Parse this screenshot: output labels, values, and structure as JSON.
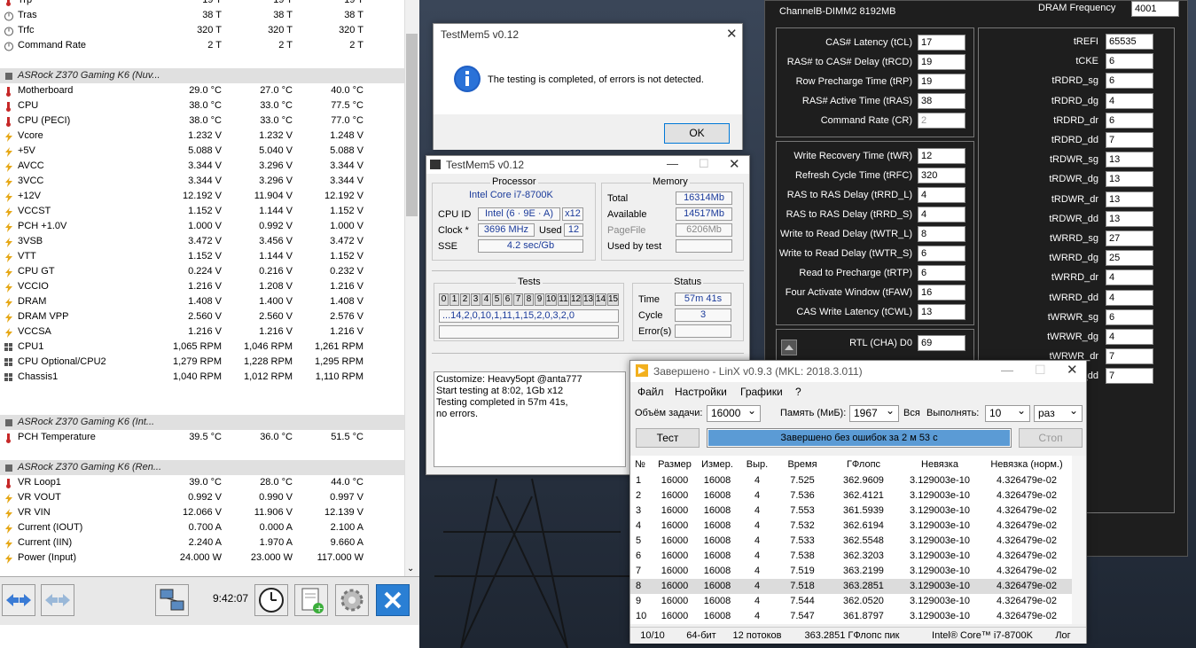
{
  "hwinfo": {
    "rows": [
      {
        "kind": "sensor",
        "icon": "temp",
        "name": "Trp",
        "c": "19 T",
        "mn": "19 T",
        "mx": "19 T"
      },
      {
        "kind": "sensor",
        "icon": "clock",
        "name": "Tras",
        "c": "38 T",
        "mn": "38 T",
        "mx": "38 T"
      },
      {
        "kind": "sensor",
        "icon": "clock",
        "name": "Trfc",
        "c": "320 T",
        "mn": "320 T",
        "mx": "320 T"
      },
      {
        "kind": "sensor",
        "icon": "clock",
        "name": "Command Rate",
        "c": "2 T",
        "mn": "2 T",
        "mx": "2 T"
      },
      {
        "kind": "blank"
      },
      {
        "kind": "group",
        "name": "ASRock Z370 Gaming K6 (Nuv..."
      },
      {
        "kind": "sensor",
        "icon": "temp",
        "name": "Motherboard",
        "c": "29.0 °C",
        "mn": "27.0 °C",
        "mx": "40.0 °C"
      },
      {
        "kind": "sensor",
        "icon": "temp",
        "name": "CPU",
        "c": "38.0 °C",
        "mn": "33.0 °C",
        "mx": "77.5 °C"
      },
      {
        "kind": "sensor",
        "icon": "temp",
        "name": "CPU (PECI)",
        "c": "38.0 °C",
        "mn": "33.0 °C",
        "mx": "77.0 °C"
      },
      {
        "kind": "sensor",
        "icon": "volt",
        "name": "Vcore",
        "c": "1.232 V",
        "mn": "1.232 V",
        "mx": "1.248 V"
      },
      {
        "kind": "sensor",
        "icon": "volt",
        "name": "+5V",
        "c": "5.088 V",
        "mn": "5.040 V",
        "mx": "5.088 V"
      },
      {
        "kind": "sensor",
        "icon": "volt",
        "name": "AVCC",
        "c": "3.344 V",
        "mn": "3.296 V",
        "mx": "3.344 V"
      },
      {
        "kind": "sensor",
        "icon": "volt",
        "name": "3VCC",
        "c": "3.344 V",
        "mn": "3.296 V",
        "mx": "3.344 V"
      },
      {
        "kind": "sensor",
        "icon": "volt",
        "name": "+12V",
        "c": "12.192 V",
        "mn": "11.904 V",
        "mx": "12.192 V"
      },
      {
        "kind": "sensor",
        "icon": "volt",
        "name": "VCCST",
        "c": "1.152 V",
        "mn": "1.144 V",
        "mx": "1.152 V"
      },
      {
        "kind": "sensor",
        "icon": "volt",
        "name": "PCH +1.0V",
        "c": "1.000 V",
        "mn": "0.992 V",
        "mx": "1.000 V"
      },
      {
        "kind": "sensor",
        "icon": "volt",
        "name": "3VSB",
        "c": "3.472 V",
        "mn": "3.456 V",
        "mx": "3.472 V"
      },
      {
        "kind": "sensor",
        "icon": "volt",
        "name": "VTT",
        "c": "1.152 V",
        "mn": "1.144 V",
        "mx": "1.152 V"
      },
      {
        "kind": "sensor",
        "icon": "volt",
        "name": "CPU GT",
        "c": "0.224 V",
        "mn": "0.216 V",
        "mx": "0.232 V"
      },
      {
        "kind": "sensor",
        "icon": "volt",
        "name": "VCCIO",
        "c": "1.216 V",
        "mn": "1.208 V",
        "mx": "1.216 V"
      },
      {
        "kind": "sensor",
        "icon": "volt",
        "name": "DRAM",
        "c": "1.408 V",
        "mn": "1.400 V",
        "mx": "1.408 V"
      },
      {
        "kind": "sensor",
        "icon": "volt",
        "name": "DRAM VPP",
        "c": "2.560 V",
        "mn": "2.560 V",
        "mx": "2.576 V"
      },
      {
        "kind": "sensor",
        "icon": "volt",
        "name": "VCCSA",
        "c": "1.216 V",
        "mn": "1.216 V",
        "mx": "1.216 V"
      },
      {
        "kind": "sensor",
        "icon": "fan",
        "name": "CPU1",
        "c": "1,065 RPM",
        "mn": "1,046 RPM",
        "mx": "1,261 RPM"
      },
      {
        "kind": "sensor",
        "icon": "fan",
        "name": "CPU Optional/CPU2",
        "c": "1,279 RPM",
        "mn": "1,228 RPM",
        "mx": "1,295 RPM"
      },
      {
        "kind": "sensor",
        "icon": "fan",
        "name": "Chassis1",
        "c": "1,040 RPM",
        "mn": "1,012 RPM",
        "mx": "1,110 RPM"
      },
      {
        "kind": "blank"
      },
      {
        "kind": "blank"
      },
      {
        "kind": "group",
        "name": "ASRock Z370 Gaming K6 (Int..."
      },
      {
        "kind": "sensor",
        "icon": "temp",
        "name": "PCH Temperature",
        "c": "39.5 °C",
        "mn": "36.0 °C",
        "mx": "51.5 °C"
      },
      {
        "kind": "blank"
      },
      {
        "kind": "group",
        "name": "ASRock Z370 Gaming K6 (Ren..."
      },
      {
        "kind": "sensor",
        "icon": "temp",
        "name": "VR Loop1",
        "c": "39.0 °C",
        "mn": "28.0 °C",
        "mx": "44.0 °C"
      },
      {
        "kind": "sensor",
        "icon": "volt",
        "name": "VR VOUT",
        "c": "0.992 V",
        "mn": "0.990 V",
        "mx": "0.997 V"
      },
      {
        "kind": "sensor",
        "icon": "volt",
        "name": "VR VIN",
        "c": "12.066 V",
        "mn": "11.906 V",
        "mx": "12.139 V"
      },
      {
        "kind": "sensor",
        "icon": "volt",
        "name": "Current (IOUT)",
        "c": "0.700 A",
        "mn": "0.000 A",
        "mx": "2.100 A"
      },
      {
        "kind": "sensor",
        "icon": "volt",
        "name": "Current (IIN)",
        "c": "2.240 A",
        "mn": "1.970 A",
        "mx": "9.660 A"
      },
      {
        "kind": "sensor",
        "icon": "volt",
        "name": "Power (Input)",
        "c": "24.000 W",
        "mn": "23.000 W",
        "mx": "117.000 W"
      },
      {
        "kind": "blank"
      },
      {
        "kind": "blank"
      },
      {
        "kind": "group",
        "name": "ASRock Z370 Gaming K6 (Ren..."
      }
    ],
    "time": "9:42:07"
  },
  "dialog": {
    "title": "TestMem5 v0.12",
    "message": "The testing is completed, of errors is not detected.",
    "ok": "OK"
  },
  "testmem": {
    "title": "TestMem5 v0.12",
    "processor_label": "Processor",
    "processor": "Intel Core i7-8700K",
    "cpuid_label": "CPU ID",
    "cpuid": "Intel  (6 · 9E · A)",
    "threads": "x12",
    "clock_label": "Clock *",
    "clock": "3696 MHz",
    "used_label": "Used",
    "used": "12",
    "sse_label": "SSE",
    "sse": "4.2 sec/Gb",
    "memory_label": "Memory",
    "total_label": "Total",
    "total": "16314Mb",
    "avail_label": "Available",
    "avail": "14517Mb",
    "pagefile_label": "PageFile",
    "pagefile": "6206Mb",
    "usedby_label": "Used by test",
    "usedby": "",
    "tests_label": "Tests",
    "test_nums": [
      "0",
      "1",
      "2",
      "3",
      "4",
      "5",
      "6",
      "7",
      "8",
      "9",
      "10",
      "11",
      "12",
      "13",
      "14",
      "15"
    ],
    "sequence": "...14,2,0,10,1,11,1,15,2,0,3,2,0",
    "status_label": "Status",
    "time_label": "Time",
    "time": "57m 41s",
    "cycle_label": "Cycle",
    "cycle": "3",
    "errors_label": "Error(s)",
    "errors": "",
    "log": [
      "Customize: Heavy5opt @anta777",
      "Start testing at 8:02, 1Gb x12",
      "Testing completed in 57m 41s,",
      "no errors."
    ]
  },
  "linx": {
    "title": "Завершено - LinX v0.9.3 (MKL: 2018.3.011)",
    "menu": [
      "Файл",
      "Настройки",
      "Графики",
      "?"
    ],
    "size_label": "Объём задачи:",
    "size": "16000",
    "mem_label": "Память (МиБ):",
    "mem": "1967",
    "all": "Вся",
    "run_label": "Выполнять:",
    "runs": "10",
    "unit": "раз",
    "test_btn": "Тест",
    "progress": "Завершено без ошибок за 2 м 53 с",
    "stop_btn": "Стоп",
    "headers": [
      "№",
      "Размер",
      "Измер.",
      "Выр.",
      "Время",
      "ГФлопс",
      "Невязка",
      "Невязка (норм.)"
    ],
    "rows": [
      [
        "1",
        "16000",
        "16008",
        "4",
        "7.525",
        "362.9609",
        "3.129003e-10",
        "4.326479e-02"
      ],
      [
        "2",
        "16000",
        "16008",
        "4",
        "7.536",
        "362.4121",
        "3.129003e-10",
        "4.326479e-02"
      ],
      [
        "3",
        "16000",
        "16008",
        "4",
        "7.553",
        "361.5939",
        "3.129003e-10",
        "4.326479e-02"
      ],
      [
        "4",
        "16000",
        "16008",
        "4",
        "7.532",
        "362.6194",
        "3.129003e-10",
        "4.326479e-02"
      ],
      [
        "5",
        "16000",
        "16008",
        "4",
        "7.533",
        "362.5548",
        "3.129003e-10",
        "4.326479e-02"
      ],
      [
        "6",
        "16000",
        "16008",
        "4",
        "7.538",
        "362.3203",
        "3.129003e-10",
        "4.326479e-02"
      ],
      [
        "7",
        "16000",
        "16008",
        "4",
        "7.519",
        "363.2199",
        "3.129003e-10",
        "4.326479e-02"
      ],
      [
        "8",
        "16000",
        "16008",
        "4",
        "7.518",
        "363.2851",
        "3.129003e-10",
        "4.326479e-02"
      ],
      [
        "9",
        "16000",
        "16008",
        "4",
        "7.544",
        "362.0520",
        "3.129003e-10",
        "4.326479e-02"
      ],
      [
        "10",
        "16000",
        "16008",
        "4",
        "7.547",
        "361.8797",
        "3.129003e-10",
        "4.326479e-02"
      ]
    ],
    "status": [
      "10/10",
      "64-бит",
      "12 потоков",
      "363.2851 ГФлопс пик",
      "Intel® Core™ i7-8700K",
      "Лог"
    ]
  },
  "timings": {
    "channel": "ChannelB-DIMM2  8192MB",
    "dram_freq_label": "DRAM Frequency",
    "dram_freq": "4001",
    "left1": [
      [
        "CAS# Latency (tCL)",
        "17"
      ],
      [
        "RAS# to CAS# Delay (tRCD)",
        "19"
      ],
      [
        "Row Precharge Time (tRP)",
        "19"
      ],
      [
        "RAS# Active Time (tRAS)",
        "38"
      ],
      [
        "Command Rate (CR)",
        "2"
      ]
    ],
    "left2": [
      [
        "Write Recovery Time (tWR)",
        "12"
      ],
      [
        "Refresh Cycle Time (tRFC)",
        "320"
      ],
      [
        "RAS to RAS Delay (tRRD_L)",
        "4"
      ],
      [
        "RAS to RAS Delay (tRRD_S)",
        "4"
      ],
      [
        "Write to Read Delay (tWTR_L)",
        "8"
      ],
      [
        "Write to Read Delay (tWTR_S)",
        "6"
      ],
      [
        "Read to Precharge (tRTP)",
        "6"
      ],
      [
        "Four Activate Window (tFAW)",
        "16"
      ],
      [
        "CAS Write Latency (tCWL)",
        "13"
      ]
    ],
    "rtl_label": "RTL (CHA) D0",
    "rtl": "69",
    "right": [
      [
        "tREFI",
        "65535"
      ],
      [
        "tCKE",
        "6"
      ],
      [
        "tRDRD_sg",
        "6"
      ],
      [
        "tRDRD_dg",
        "4"
      ],
      [
        "tRDRD_dr",
        "6"
      ],
      [
        "tRDRD_dd",
        "7"
      ],
      [
        "tRDWR_sg",
        "13"
      ],
      [
        "tRDWR_dg",
        "13"
      ],
      [
        "tRDWR_dr",
        "13"
      ],
      [
        "tRDWR_dd",
        "13"
      ],
      [
        "tWRRD_sg",
        "27"
      ],
      [
        "tWRRD_dg",
        "25"
      ],
      [
        "tWRRD_dr",
        "4"
      ],
      [
        "tWRRD_dd",
        "4"
      ],
      [
        "tWRWR_sg",
        "6"
      ],
      [
        "tWRWR_dg",
        "4"
      ],
      [
        "tWRWR_dr",
        "7"
      ],
      [
        "tWRWR_dd",
        "7"
      ]
    ]
  }
}
